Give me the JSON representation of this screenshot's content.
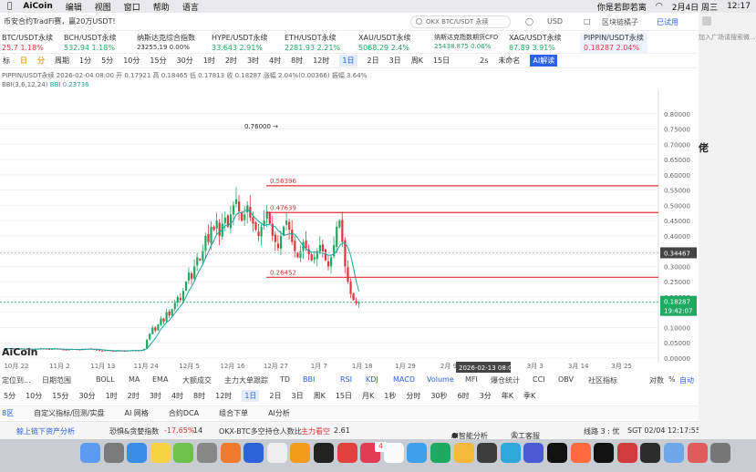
{
  "menubar": {
    "app": "AiCoin",
    "items": [
      "编辑",
      "视图",
      "窗口",
      "帮助",
      "语言"
    ],
    "status": "你是若即若离",
    "date": "2月4日 周三",
    "time": "12:17"
  },
  "topbar": {
    "promo": "币安合约TradFi赛，赢20万USDT!",
    "search_placeholder": "OKX BTC/USDT 永续",
    "currency": "USD",
    "watch": "区块链橘子",
    "status": "已试用"
  },
  "tickers": [
    {
      "name": "BTC/USDT永续",
      "value": "25.7  1.18%",
      "color": "#e0333a"
    },
    {
      "name": "BCH/USDT永续",
      "value": "532.94  1.18%",
      "color": "#1ea860"
    },
    {
      "name": "纳斯达克综合指数",
      "value": "23255.19  0.00%",
      "color": "#333333"
    },
    {
      "name": "HYPE/USDT永续",
      "value": "33.643  2.91%",
      "color": "#1ea860"
    },
    {
      "name": "ETH/USDT永续",
      "value": "2281.93  2.21%",
      "color": "#1ea860"
    },
    {
      "name": "XAU/USDT永续",
      "value": "5068.29  2.4%",
      "color": "#1ea860"
    },
    {
      "name": "纳斯达克指数期货CFD",
      "value": "25438.875  0.06%",
      "color": "#1ea860"
    },
    {
      "name": "XAG/USDT永续",
      "value": "87.89  3.91%",
      "color": "#1ea860"
    },
    {
      "name": "PIPPIN/USDT永续",
      "value": "0.18287  2.04%",
      "color": "#e0333a"
    }
  ],
  "toolbar": {
    "items": [
      "标",
      "日",
      "分",
      "周期",
      "1分",
      "5分",
      "10分",
      "15分",
      "30分",
      "1时",
      "2时",
      "3时",
      "4时",
      "8时",
      "12时",
      "1日",
      "2日",
      "3日",
      "周K",
      "15日"
    ],
    "selected": "1日",
    "right": [
      "2s",
      "未命名",
      "AI解读"
    ]
  },
  "info": {
    "line1": "PIPPIN/USDT永续  2026-02-04 08:00  开 0.17921  高 0.18465  低 0.17813  收 0.18287  涨幅 2.04%(0.00366)  振幅 3.64%",
    "line2_label": "BBI(3,6,12,24)",
    "line2_value": "BBI 0.23736"
  },
  "chart_data": {
    "type": "candlestick",
    "title": "PIPPIN/USDT永续",
    "xlabel": "",
    "ylabel": "",
    "ylim": [
      0,
      0.85
    ],
    "y_ticks": [
      0.0,
      0.05,
      0.1,
      0.15,
      0.2,
      0.25,
      0.3,
      0.35,
      0.4,
      0.45,
      0.5,
      0.55,
      0.6,
      0.65,
      0.7,
      0.75,
      0.8
    ],
    "y_tick_labels": [
      "0.00000",
      "0.05000",
      "0.10000",
      "0.15000",
      "0.20000",
      "0.25000",
      "0.30000",
      "0.35000",
      "0.40000",
      "0.45000",
      "0.50000",
      "0.55000",
      "0.60000",
      "0.65000",
      "0.70000",
      "0.75000",
      "0.80000"
    ],
    "x_tick_labels": [
      "10月 22",
      "11月 2",
      "11月 13",
      "11月 24",
      "12月 5",
      "12月 16",
      "12月 27",
      "1月 7",
      "1月 18",
      "1月 29",
      "2月 9",
      "2月 20",
      "3月 3",
      "3月 14",
      "3月 25"
    ],
    "series_close": [
      0.03,
      0.032,
      0.031,
      0.03,
      0.029,
      0.03,
      0.031,
      0.03,
      0.029,
      0.028,
      0.029,
      0.03,
      0.031,
      0.032,
      0.031,
      0.03,
      0.029,
      0.03,
      0.031,
      0.03,
      0.029,
      0.028,
      0.027,
      0.028,
      0.03,
      0.029,
      0.028,
      0.027,
      0.029,
      0.03,
      0.031,
      0.03,
      0.028,
      0.026,
      0.025,
      0.024,
      0.026,
      0.025,
      0.024,
      0.023,
      0.024,
      0.025,
      0.024,
      0.023,
      0.024,
      0.025,
      0.026,
      0.025,
      0.024,
      0.026,
      0.03,
      0.06,
      0.08,
      0.1,
      0.09,
      0.11,
      0.13,
      0.12,
      0.15,
      0.14,
      0.16,
      0.18,
      0.2,
      0.19,
      0.22,
      0.25,
      0.28,
      0.26,
      0.3,
      0.33,
      0.32,
      0.35,
      0.4,
      0.38,
      0.43,
      0.42,
      0.45,
      0.4,
      0.44,
      0.46,
      0.43,
      0.47,
      0.5,
      0.52,
      0.48,
      0.45,
      0.47,
      0.5,
      0.46,
      0.44,
      0.42,
      0.4,
      0.43,
      0.45,
      0.48,
      0.44,
      0.4,
      0.38,
      0.36,
      0.4,
      0.43,
      0.45,
      0.42,
      0.38,
      0.35,
      0.33,
      0.35,
      0.38,
      0.36,
      0.34,
      0.32,
      0.33,
      0.35,
      0.37,
      0.35,
      0.32,
      0.3,
      0.33,
      0.37,
      0.43,
      0.45,
      0.38,
      0.3,
      0.25,
      0.21,
      0.19,
      0.18,
      0.18287
    ],
    "series_open_offsets": "computed",
    "price_lines": [
      {
        "label": "0.56396",
        "value": 0.56396,
        "color": "#e0333a"
      },
      {
        "label": "0.47639",
        "value": 0.47639,
        "color": "#e0333a"
      },
      {
        "label": "0.26452",
        "value": 0.26452,
        "color": "#e0333a"
      }
    ],
    "peak_label": "0.76000",
    "peak_value": 0.76,
    "price_tags": [
      {
        "label": "0.34467",
        "value": 0.34467
      },
      {
        "label": "0.18287",
        "value": 0.18287,
        "sub": "19:42:07"
      }
    ],
    "crosshair_date": "2026-02-13 08:00",
    "legend_location": "none"
  },
  "chart_watermark": "AiCoin",
  "indicators": {
    "left": [
      "定位到...",
      "日期范围"
    ],
    "items": [
      "BOLL",
      "MA",
      "EMA",
      "大额成交",
      "主力大单跟踪",
      "TD",
      "BBI",
      "RSI",
      "KDJ",
      "MACD",
      "Volume",
      "MFI",
      "爆仓统计",
      "CCI",
      "OBV",
      "社区指标"
    ],
    "right": [
      "对数",
      "%",
      "自动"
    ]
  },
  "periodbar": {
    "items": [
      "5分",
      "10分",
      "15分",
      "30分",
      "1时",
      "2时",
      "3时",
      "4时",
      "8时",
      "12时",
      "1日",
      "2日",
      "3日",
      "周K",
      "15日",
      "月K",
      "1秒",
      "分时",
      "30秒",
      "6时",
      "3分",
      "年K",
      "季K"
    ],
    "selected": "1日"
  },
  "tabsbar": [
    "8区",
    "自定义指标/回测/实盘",
    "AI 网格",
    "合约DCA",
    "组合下单",
    "AI分析"
  ],
  "statusbar": {
    "news": "鲸上链下资产分析",
    "fear_label": "恐惧&贪婪指数",
    "fear_change": "-17.65%",
    "fear_value": "14",
    "okx_label": "OKX-BTC多空持仓人数比",
    "okx_tag": "主力看空",
    "okx_value": "2.61",
    "ai": "AI智能分析",
    "service": "人工客服",
    "line": "线路 3 : 优",
    "clock": "SGT 02/04 12:17:55"
  },
  "rightstrip": {
    "ad": "加入广场请搜索微...",
    "title": "佬"
  },
  "dock": {
    "badge": "4"
  }
}
